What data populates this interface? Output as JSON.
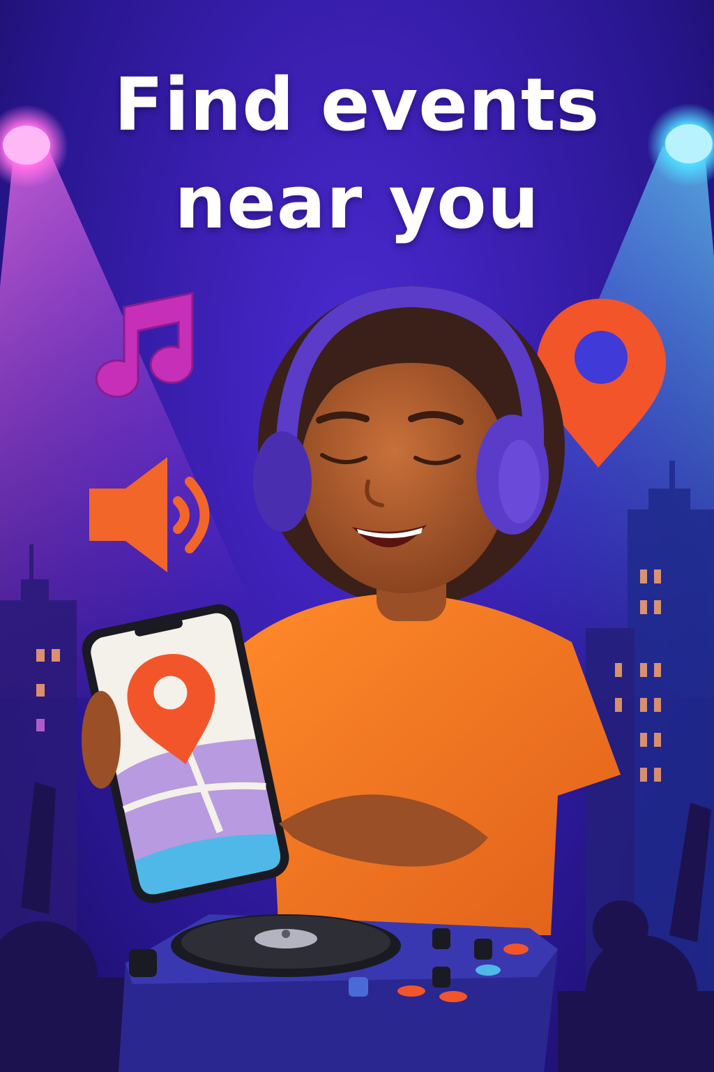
{
  "headline": {
    "line1": "Find events",
    "line2": "near you"
  },
  "icons": [
    "music-note-icon",
    "location-pin-icon",
    "speaker-icon",
    "headphones-icon",
    "phone-map-icon",
    "turntable-icon"
  ],
  "colors": {
    "background": "#3a1fb0",
    "accent_orange": "#f2552a",
    "shirt_orange": "#f2761e",
    "note_magenta": "#c62fb8",
    "headphones_purple": "#5a3cc8",
    "spotlight_pink": "#ff6ee8",
    "spotlight_cyan": "#4fd8ff"
  }
}
